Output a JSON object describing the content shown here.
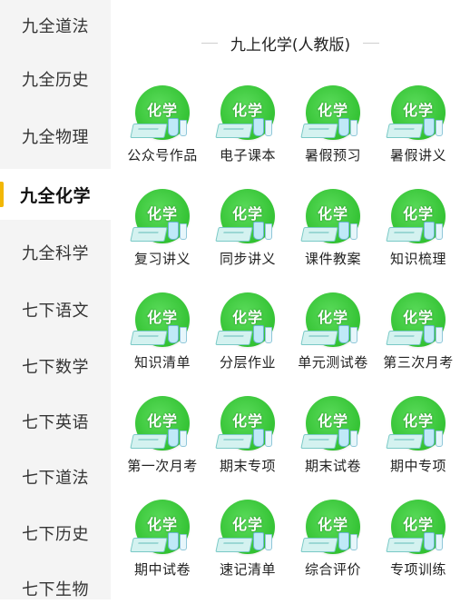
{
  "sidebar": {
    "items": [
      {
        "label": "九全道法"
      },
      {
        "label": "九全历史"
      },
      {
        "label": "九全物理"
      },
      {
        "label": "九全化学"
      },
      {
        "label": "九全科学"
      },
      {
        "label": "七下语文"
      },
      {
        "label": "七下数学"
      },
      {
        "label": "七下英语"
      },
      {
        "label": "七下道法"
      },
      {
        "label": "七下历史"
      },
      {
        "label": "七下生物"
      }
    ],
    "active_index": 3
  },
  "section": {
    "title": "九上化学(人教版)"
  },
  "badge_text": "化学",
  "colors": {
    "badge_green": "#33c233",
    "active_accent": "#f2b705",
    "sidebar_bg": "#f4f4f4"
  },
  "items": [
    {
      "label": "公众号作品"
    },
    {
      "label": "电子课本"
    },
    {
      "label": "暑假预习"
    },
    {
      "label": "暑假讲义"
    },
    {
      "label": "复习讲义"
    },
    {
      "label": "同步讲义"
    },
    {
      "label": "课件教案"
    },
    {
      "label": "知识梳理"
    },
    {
      "label": "知识清单"
    },
    {
      "label": "分层作业"
    },
    {
      "label": "单元测试卷"
    },
    {
      "label": "第三次月考"
    },
    {
      "label": "第一次月考"
    },
    {
      "label": "期末专项"
    },
    {
      "label": "期末试卷"
    },
    {
      "label": "期中专项"
    },
    {
      "label": "期中试卷"
    },
    {
      "label": "速记清单"
    },
    {
      "label": "综合评价"
    },
    {
      "label": "专项训练"
    }
  ]
}
